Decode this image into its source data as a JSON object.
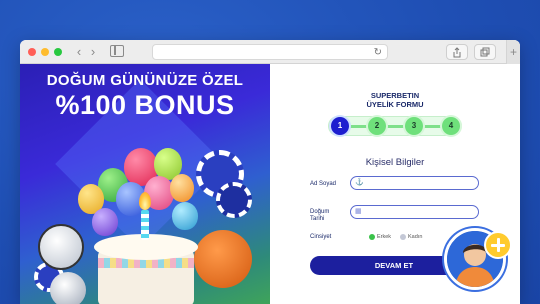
{
  "browser": {
    "back_icon": "chevron-left-icon",
    "forward_icon": "chevron-right-icon",
    "reload_icon": "reload-icon",
    "share_icon": "share-icon",
    "tabs_icon": "tabs-icon",
    "new_tab_icon": "plus-icon"
  },
  "promo": {
    "headline": "DOĞUM GÜNÜNÜZE ÖZEL",
    "bonus": "%100 BONUS"
  },
  "form": {
    "brand_line1": "SUPERBETIN",
    "brand_line2": "ÜYELİK FORMU",
    "steps": [
      "1",
      "2",
      "3",
      "4"
    ],
    "active_step": 1,
    "section_title": "Kişisel Bilgiler",
    "fields": {
      "name_label": "Ad Soyad",
      "birth_label_line1": "Doğum",
      "birth_label_line2": "Tarihi",
      "gender_label": "Cinsiyet",
      "gender_options": [
        "Erkek",
        "Kadın"
      ],
      "gender_selected": "Erkek"
    },
    "submit_label": "DEVAM ET"
  },
  "colors": {
    "page_bg": "#1f4fb4",
    "accent_navy": "#1c1f9e",
    "step_active": "#1d1ecf",
    "step_idle": "#6fe07b",
    "badge_yellow": "#ffcb2e"
  }
}
